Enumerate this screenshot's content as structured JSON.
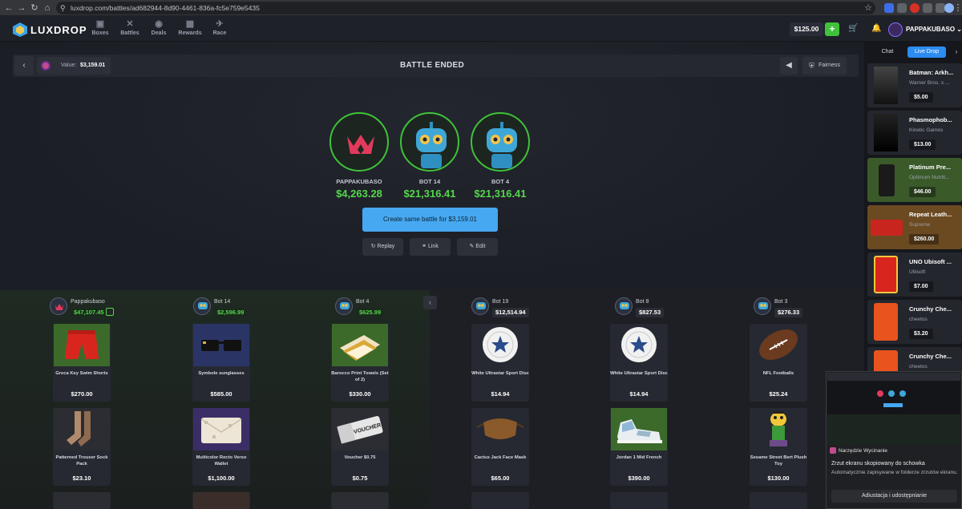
{
  "browser": {
    "url": "luxdrop.com/battles/ad682944-8d90-4461-836a-fc5e759e5435"
  },
  "nav": {
    "brand": "LUXDROP",
    "items": [
      {
        "label": "Boxes",
        "icon": "box-icon"
      },
      {
        "label": "Battles",
        "icon": "swords-icon"
      },
      {
        "label": "Deals",
        "icon": "deals-icon"
      },
      {
        "label": "Rewards",
        "icon": "gift-icon"
      },
      {
        "label": "Race",
        "icon": "race-icon"
      }
    ],
    "balance": "$125.00",
    "deposit": "+",
    "username": "PAPPAKUBASO"
  },
  "battle": {
    "value_label": "Value:",
    "value": "$3,159.01",
    "status": "BATTLE ENDED",
    "fairness": "Fairness",
    "players": [
      {
        "name": "PAPPAKUBASO",
        "total": "$4,263.28"
      },
      {
        "name": "BOT 14",
        "total": "$21,316.41"
      },
      {
        "name": "BOT 4",
        "total": "$21,316.41"
      }
    ],
    "create_label": "Create same battle for $3,159.01",
    "replay": "Replay",
    "link": "Link",
    "edit": "Edit"
  },
  "columns": [
    {
      "name": "Pappakubaso",
      "value": "$47,107.45",
      "value_color": "#55d64d",
      "cards": [
        {
          "name": "Greca Key Swim Shorts",
          "price": "$270.00"
        },
        {
          "name": "Patterned Trouser Sock Pack",
          "price": "$23.10"
        }
      ]
    },
    {
      "name": "Bot 14",
      "value": "$2,596.99",
      "value_color": "#55d64d",
      "cards": [
        {
          "name": "Symbole sunglasses",
          "price": "$585.00"
        },
        {
          "name": "Multicolor Recto Verso Wallet",
          "price": "$1,100.00"
        }
      ]
    },
    {
      "name": "Bot 4",
      "value": "$625.99",
      "value_color": "#55d64d",
      "cards": [
        {
          "name": "Barocco Print Towels (Set of 2)",
          "price": "$330.00"
        },
        {
          "name": "Voucher $0.75",
          "price": "$0.75"
        }
      ]
    },
    {
      "name": "Bot 19",
      "value": "$12,514.94",
      "value_color": "#ffffff",
      "cards": [
        {
          "name": "White Ultrastar Sport Disc",
          "price": "$14.94"
        },
        {
          "name": "Cactus Jack Face Mask",
          "price": "$65.00"
        }
      ]
    },
    {
      "name": "Bot 8",
      "value": "$827.53",
      "value_color": "#ffffff",
      "cards": [
        {
          "name": "White Ultrastar Sport Disc",
          "price": "$14.94"
        },
        {
          "name": "Jordan 1 Mid French",
          "price": "$390.00"
        }
      ]
    },
    {
      "name": "Bot 3",
      "value": "$276.33",
      "value_color": "#ffffff",
      "cards": [
        {
          "name": "NFL Footballs",
          "price": "$25.24"
        },
        {
          "name": "Sesame Street Bert Plush Toy",
          "price": "$130.00"
        }
      ]
    }
  ],
  "sidebar": {
    "tab_chat": "Chat",
    "tab_live": "Live Drop",
    "drops": [
      {
        "name": "Batman: Arkh...",
        "sub": "Warner Bros. x ...",
        "price": "$5.00",
        "bg": "#23262d"
      },
      {
        "name": "Phasmophob...",
        "sub": "Kinetic Games",
        "price": "$13.00",
        "bg": "#23262d"
      },
      {
        "name": "Platinum Pre...",
        "sub": "Optimum Nutriti...",
        "price": "$46.00",
        "bg": "#3b5a2a"
      },
      {
        "name": "Repeat Leath...",
        "sub": "Supreme",
        "price": "$260.00",
        "bg": "#6b4a22"
      },
      {
        "name": "UNO Ubisoft ...",
        "sub": "Ubisoft",
        "price": "$7.00",
        "bg": "#23262d"
      },
      {
        "name": "Crunchy Che...",
        "sub": "cheetos",
        "price": "$3.20",
        "bg": "#23262d"
      },
      {
        "name": "Crunchy Che...",
        "sub": "cheetos",
        "price": "",
        "bg": "#23262d"
      }
    ]
  },
  "snip": {
    "title": "Narzędzie Wycinanie",
    "line1": "Zrzut ekranu skopiowany do schowka",
    "line2": "Automatycznie zapisywane w folderze zrzutów ekranu.",
    "button": "Adiustacja i udostępnianie"
  }
}
